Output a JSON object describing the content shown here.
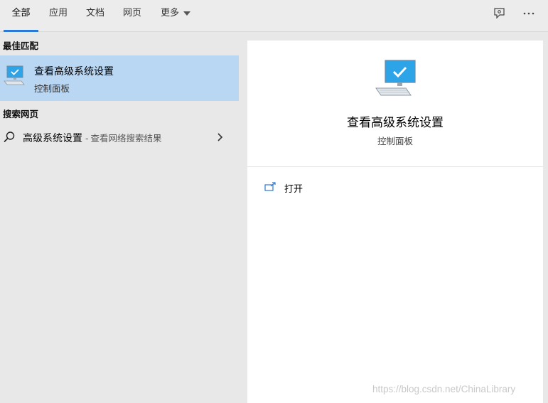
{
  "tabs": [
    {
      "label": "全部",
      "active": true
    },
    {
      "label": "应用",
      "active": false
    },
    {
      "label": "文档",
      "active": false
    },
    {
      "label": "网页",
      "active": false
    },
    {
      "label": "更多",
      "active": false
    }
  ],
  "left": {
    "best_match_header": "最佳匹配",
    "best_match": {
      "title": "查看高级系统设置",
      "subtitle": "控制面板",
      "icon": "monitor-check-icon"
    },
    "web_header": "搜索网页",
    "web_result": {
      "query": "高级系统设置",
      "separator": "-",
      "hint": "查看网络搜索结果"
    }
  },
  "preview": {
    "title": "查看高级系统设置",
    "subtitle": "控制面板",
    "actions": [
      {
        "label": "打开",
        "icon": "open-icon"
      }
    ]
  },
  "watermark": "https://blog.csdn.net/ChinaLibrary",
  "colors": {
    "selected_bg": "#b9d6f2",
    "accent": "#2a79d4",
    "icon_blue": "#2ea4e8"
  }
}
